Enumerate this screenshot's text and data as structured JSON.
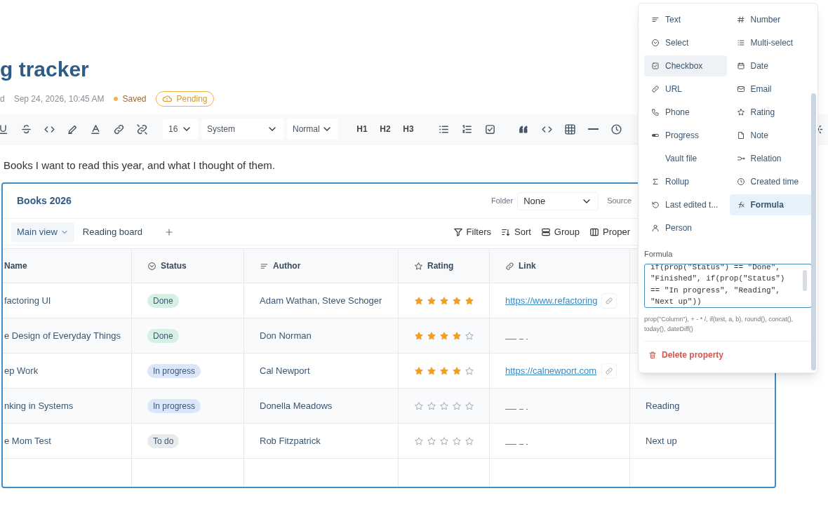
{
  "title": "g tracker",
  "meta": {
    "edited_label": "d",
    "timestamp": "Sep 24, 2026, 10:45 AM",
    "save_state": "Saved",
    "sync_badge": "Pending"
  },
  "toolbar": {
    "size": "16",
    "font": "System",
    "style": "Normal",
    "headings": [
      "H1",
      "H2",
      "H3"
    ]
  },
  "description": "Books I want to read this year, and what I thought of them.",
  "database": {
    "title": "Books 2026",
    "folder_label": "Folder",
    "folder": "None",
    "source_label": "Source",
    "views": [
      {
        "label": "Main view",
        "selected": true
      },
      {
        "label": "Reading board",
        "selected": false
      }
    ],
    "actions": [
      "Filters",
      "Sort",
      "Group",
      "Proper"
    ],
    "columns": [
      "Name",
      "Status",
      "Author",
      "Rating",
      "Link"
    ],
    "rows": [
      {
        "name": "factoring UI",
        "status": {
          "label": "Done",
          "color": "#d5f1e6"
        },
        "author": "Adam Wathan, Steve Schoger",
        "stars": 5,
        "link": "https://www.refactoring"
      },
      {
        "name": "e Design of Everyday Things",
        "status": {
          "label": "Done",
          "color": "#d5f1e6"
        },
        "author": "Don Norman",
        "stars": 4
      },
      {
        "name": "ep Work",
        "status": {
          "label": "In progress",
          "color": "#dbe6fb"
        },
        "author": "Cal Newport",
        "stars": 4,
        "link": "https://calnewport.com"
      },
      {
        "name": "nking in Systems",
        "status": {
          "label": "In progress",
          "color": "#dbe6fb"
        },
        "author": "Donella Meadows",
        "stars": 0,
        "formula": "Reading"
      },
      {
        "name": "e Mom Test",
        "status": {
          "label": "To do",
          "color": "#e8eaed"
        },
        "author": "Rob Fitzpatrick",
        "stars": 0,
        "formula": "Next up"
      }
    ]
  },
  "property_menu": {
    "types": [
      {
        "label": "Text",
        "selected": false,
        "highlighted": false
      },
      {
        "label": "Number",
        "selected": false,
        "highlighted": false
      },
      {
        "label": "Select",
        "selected": false,
        "highlighted": false
      },
      {
        "label": "Multi-select",
        "selected": false,
        "highlighted": false
      },
      {
        "label": "Checkbox",
        "selected": false,
        "highlighted": true
      },
      {
        "label": "Date",
        "selected": false,
        "highlighted": false
      },
      {
        "label": "URL",
        "selected": false,
        "highlighted": false
      },
      {
        "label": "Email",
        "selected": false,
        "highlighted": false
      },
      {
        "label": "Phone",
        "selected": false,
        "highlighted": false
      },
      {
        "label": "Rating",
        "selected": false,
        "highlighted": false
      },
      {
        "label": "Progress",
        "selected": false,
        "highlighted": false
      },
      {
        "label": "Note",
        "selected": false,
        "highlighted": false
      },
      {
        "label": "Vault file",
        "selected": false,
        "highlighted": false
      },
      {
        "label": "Relation",
        "selected": false,
        "highlighted": false
      },
      {
        "label": "Rollup",
        "selected": false,
        "highlighted": false
      },
      {
        "label": "Created time",
        "selected": false,
        "highlighted": false
      },
      {
        "label": "Last edited t...",
        "selected": false,
        "highlighted": false
      },
      {
        "label": "Formula",
        "selected": true,
        "highlighted": false
      },
      {
        "label": "Person",
        "selected": false,
        "highlighted": false
      }
    ],
    "formula_label": "Formula",
    "formula": "if(prop(\"Status\") == \"Done\", \"Finished\", if(prop(\"Status\") == \"In progress\", \"Reading\", \"Next up\"))",
    "hint": "prop(\"Column\"), + - * /, if(test, a, b), round(), concat(), today(), dateDiff()",
    "delete": "Delete property"
  }
}
